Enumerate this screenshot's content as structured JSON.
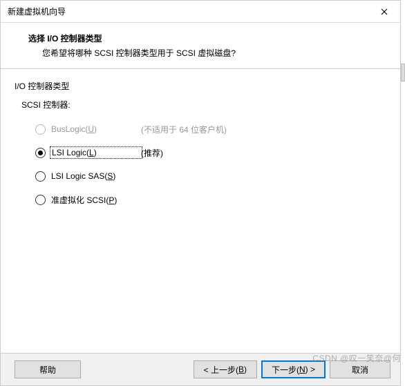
{
  "titlebar": {
    "title": "新建虚拟机向导"
  },
  "header": {
    "title": "选择 I/O 控制器类型",
    "desc": "您希望将哪种 SCSI 控制器类型用于 SCSI 虚拟磁盘?"
  },
  "group": {
    "label": "I/O 控制器类型",
    "sublabel": "SCSI 控制器:"
  },
  "options": {
    "buslogic": {
      "label": "BusLogic(",
      "hotkey": "U",
      "labelEnd": ")",
      "suffix": "(不适用于 64 位客户机)"
    },
    "lsilogic": {
      "label": "LSI Logic(",
      "hotkey": "L",
      "labelEnd": ")",
      "suffix": "(推荐)"
    },
    "lsisas": {
      "label": "LSI Logic SAS(",
      "hotkey": "S",
      "labelEnd": ")"
    },
    "paravirt": {
      "label": "准虚拟化 SCSI(",
      "hotkey": "P",
      "labelEnd": ")"
    }
  },
  "footer": {
    "help": "帮助",
    "back": {
      "pre": "< 上一步(",
      "hotkey": "B",
      "post": ")"
    },
    "next": {
      "pre": "下一步(",
      "hotkey": "N",
      "post": ") >"
    },
    "cancel": "取消"
  },
  "watermark": "CSDN @叹一笑奈@何"
}
